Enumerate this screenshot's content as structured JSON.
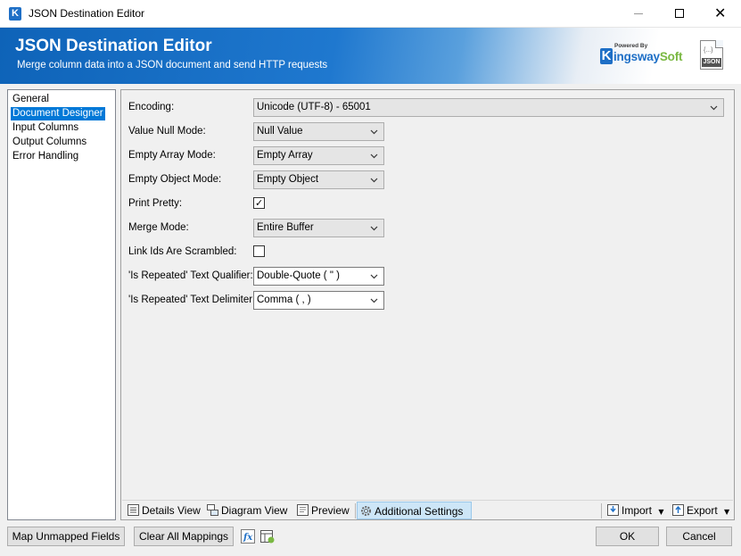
{
  "window": {
    "title": "JSON Destination Editor",
    "minimize_glyph": "",
    "close_glyph": "✕"
  },
  "banner": {
    "title": "JSON Destination Editor",
    "subtitle": "Merge column data into a JSON document and send HTTP requests",
    "logo_powered_by": "Powered By",
    "logo_k": "K",
    "logo_name_part1": "ingsway",
    "logo_name_part2": "Soft",
    "file_icon_label": "JSON",
    "file_icon_braces": "{...}"
  },
  "nav": {
    "items": [
      {
        "label": "General",
        "selected": false
      },
      {
        "label": "Document Designer",
        "selected": true
      },
      {
        "label": "Input Columns",
        "selected": false
      },
      {
        "label": "Output Columns",
        "selected": false
      },
      {
        "label": "Error Handling",
        "selected": false
      }
    ]
  },
  "settings": {
    "encoding": {
      "label": "Encoding:",
      "value": "Unicode (UTF-8) - 65001"
    },
    "value_null_mode": {
      "label": "Value Null Mode:",
      "value": "Null Value"
    },
    "empty_array_mode": {
      "label": "Empty Array Mode:",
      "value": "Empty Array"
    },
    "empty_object_mode": {
      "label": "Empty Object Mode:",
      "value": "Empty Object"
    },
    "print_pretty": {
      "label": "Print Pretty:",
      "checked": true,
      "mark": "✓"
    },
    "merge_mode": {
      "label": "Merge Mode:",
      "value": "Entire Buffer"
    },
    "link_ids_scrambled": {
      "label": "Link Ids Are Scrambled:",
      "checked": false
    },
    "text_qualifier": {
      "label": "'Is Repeated' Text Qualifier:",
      "value": "Double-Quote ( \" )"
    },
    "text_delimiter": {
      "label": "'Is Repeated' Text Delimiter:",
      "value": "Comma ( , )"
    }
  },
  "tabs": {
    "details_view": "Details View",
    "diagram_view": "Diagram View",
    "preview": "Preview",
    "additional_settings": "Additional Settings",
    "import": "Import",
    "export": "Export"
  },
  "footer": {
    "map_unmapped": "Map Unmapped Fields",
    "clear_all": "Clear All Mappings",
    "ok": "OK",
    "cancel": "Cancel"
  },
  "colors": {
    "accent": "#0078d7",
    "brand_blue": "#1e6fc6",
    "brand_green": "#7ab842"
  }
}
